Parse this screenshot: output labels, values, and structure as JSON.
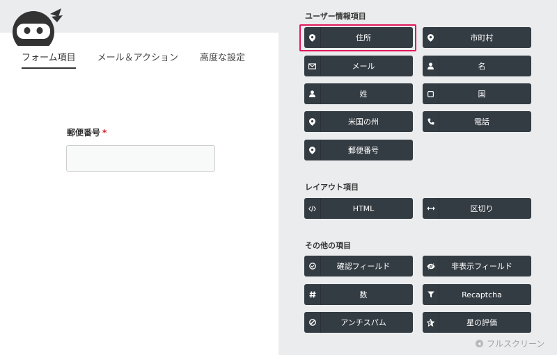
{
  "tabs": [
    {
      "label": "フォーム項目",
      "active": true
    },
    {
      "label": "メール＆アクション",
      "active": false
    },
    {
      "label": "高度な設定",
      "active": false
    }
  ],
  "form": {
    "field_label": "郵便番号",
    "required_mark": "*"
  },
  "sections": {
    "user_info": "ユーザー情報項目",
    "layout": "レイアウト項目",
    "other": "その他の項目"
  },
  "user_fields": [
    {
      "label": "住所",
      "icon": "map-pin-icon"
    },
    {
      "label": "市町村",
      "icon": "map-pin-icon"
    },
    {
      "label": "メール",
      "icon": "envelope-icon"
    },
    {
      "label": "名",
      "icon": "user-icon"
    },
    {
      "label": "姓",
      "icon": "user-icon"
    },
    {
      "label": "国",
      "icon": "square-icon"
    },
    {
      "label": "米国の州",
      "icon": "map-pin-icon"
    },
    {
      "label": "電話",
      "icon": "phone-icon"
    },
    {
      "label": "郵便番号",
      "icon": "map-pin-icon"
    }
  ],
  "layout_fields": [
    {
      "label": "HTML",
      "icon": "code-icon"
    },
    {
      "label": "区切り",
      "icon": "arrows-horizontal-icon"
    }
  ],
  "other_fields": [
    {
      "label": "確認フィールド",
      "icon": "check-circle-icon"
    },
    {
      "label": "非表示フィールド",
      "icon": "eye-slash-icon"
    },
    {
      "label": "数",
      "icon": "hash-icon"
    },
    {
      "label": "Recaptcha",
      "icon": "filter-icon"
    },
    {
      "label": "アンチスパム",
      "icon": "ban-icon"
    },
    {
      "label": "星の評価",
      "icon": "star-icon"
    }
  ],
  "fullscreen_label": "フルスクリーン",
  "colors": {
    "button_bg": "#343c43",
    "highlight": "#e0185c",
    "required": "#d4202e",
    "panel_bg": "#ebeced"
  }
}
